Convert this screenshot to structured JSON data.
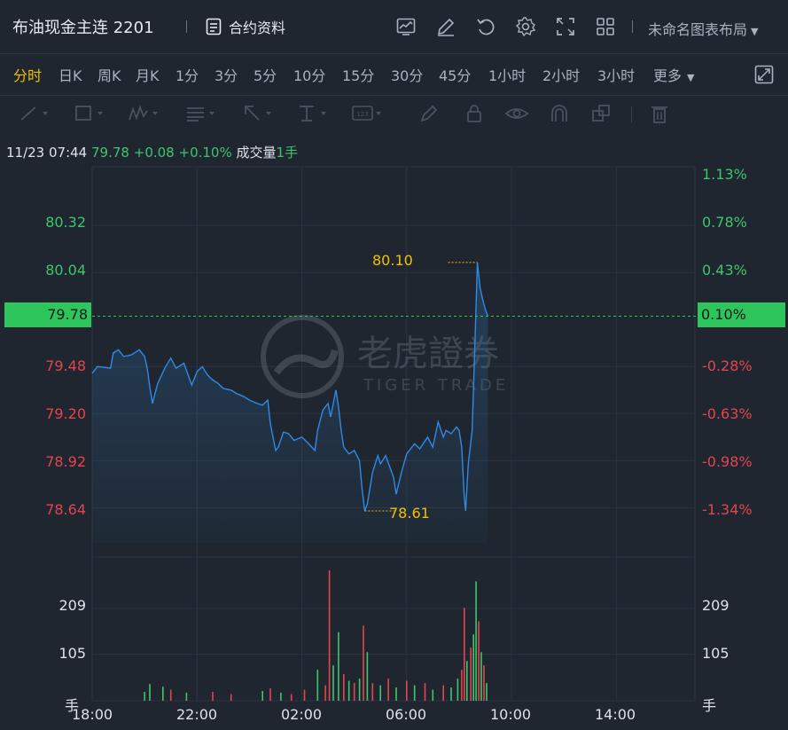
{
  "header": {
    "title": "布油现金主连 2201",
    "info_label": "合约资料",
    "layout_label": "未命名图表布局",
    "icons": [
      "chart-icon",
      "edit-icon",
      "undo-icon",
      "settings-icon",
      "fullscreen-icon",
      "grid-icon"
    ]
  },
  "periods": {
    "items": [
      "分时",
      "日K",
      "周K",
      "月K",
      "1分",
      "3分",
      "5分",
      "10分",
      "15分",
      "30分",
      "45分",
      "1小时",
      "2小时",
      "3小时",
      "更多"
    ],
    "active": "分时"
  },
  "tools": [
    "line-tool-icon",
    "rect-tool-icon",
    "wave-tool-icon",
    "fib-tool-icon",
    "arrow-tool-icon",
    "measure-tool-icon",
    "text-tool-icon",
    "brush-icon",
    "lock-icon",
    "eye-icon",
    "magnet-icon",
    "layers-icon",
    "trash-icon"
  ],
  "info_bar": {
    "time": "11/23 07:44",
    "price": "79.78",
    "change": "+0.08",
    "change_pct": "+0.10%",
    "volume_label": "成交量",
    "volume": "1手"
  },
  "watermark": {
    "name": "老虎證券",
    "sub": "TIGER TRADE"
  },
  "chart_data": {
    "type": "line",
    "price_labels": [
      "80.32",
      "80.04",
      "79.48",
      "79.20",
      "78.92",
      "78.64"
    ],
    "pct_labels": [
      "1.13%",
      "0.78%",
      "0.43%",
      "-0.28%",
      "-0.63%",
      "-0.98%",
      "-1.34%"
    ],
    "current_price": "79.78",
    "current_pct": "0.10%",
    "high_label": "80.10",
    "low_label": "78.61",
    "volume_labels": [
      "209",
      "105"
    ],
    "volume_unit": "手",
    "time_labels": [
      "18:00",
      "22:00",
      "02:00",
      "06:00",
      "10:00",
      "14:00"
    ],
    "ylim": [
      78.43,
      80.67
    ],
    "x_hours_range": [
      0,
      23
    ],
    "vol_ylim": [
      0,
      313
    ],
    "colors": {
      "line": "#2e8ae6",
      "up": "#3ec56c",
      "down": "#e2454e",
      "highlight": "#f0c000"
    },
    "points": [
      [
        0.0,
        79.44
      ],
      [
        0.2,
        79.48
      ],
      [
        0.7,
        79.47
      ],
      [
        0.8,
        79.56
      ],
      [
        1.0,
        79.58
      ],
      [
        1.2,
        79.54
      ],
      [
        1.5,
        79.55
      ],
      [
        1.8,
        79.58
      ],
      [
        2.0,
        79.54
      ],
      [
        2.1,
        79.47
      ],
      [
        2.2,
        79.36
      ],
      [
        2.3,
        79.26
      ],
      [
        2.5,
        79.38
      ],
      [
        2.8,
        79.48
      ],
      [
        3.0,
        79.53
      ],
      [
        3.2,
        79.47
      ],
      [
        3.5,
        79.5
      ],
      [
        3.8,
        79.37
      ],
      [
        4.0,
        79.45
      ],
      [
        4.2,
        79.48
      ],
      [
        4.4,
        79.43
      ],
      [
        4.6,
        79.4
      ],
      [
        4.8,
        79.38
      ],
      [
        5.0,
        79.35
      ],
      [
        5.3,
        79.34
      ],
      [
        5.5,
        79.32
      ],
      [
        5.8,
        79.3
      ],
      [
        6.0,
        79.28
      ],
      [
        6.3,
        79.26
      ],
      [
        6.5,
        79.25
      ],
      [
        6.7,
        79.28
      ],
      [
        6.8,
        79.14
      ],
      [
        6.9,
        79.06
      ],
      [
        7.0,
        78.98
      ],
      [
        7.1,
        79.0
      ],
      [
        7.3,
        79.09
      ],
      [
        7.5,
        79.08
      ],
      [
        7.7,
        79.04
      ],
      [
        8.0,
        79.06
      ],
      [
        8.2,
        79.03
      ],
      [
        8.5,
        78.98
      ],
      [
        8.6,
        79.1
      ],
      [
        8.8,
        79.22
      ],
      [
        9.0,
        79.26
      ],
      [
        9.1,
        79.18
      ],
      [
        9.3,
        79.34
      ],
      [
        9.4,
        79.24
      ],
      [
        9.5,
        79.1
      ],
      [
        9.6,
        79.0
      ],
      [
        9.8,
        78.96
      ],
      [
        10.0,
        78.98
      ],
      [
        10.2,
        78.92
      ],
      [
        10.3,
        78.75
      ],
      [
        10.4,
        78.62
      ],
      [
        10.5,
        78.66
      ],
      [
        10.7,
        78.85
      ],
      [
        10.9,
        78.95
      ],
      [
        11.0,
        78.9
      ],
      [
        11.2,
        78.95
      ],
      [
        11.5,
        78.82
      ],
      [
        11.6,
        78.72
      ],
      [
        11.8,
        78.85
      ],
      [
        12.0,
        78.96
      ],
      [
        12.3,
        79.02
      ],
      [
        12.5,
        78.99
      ],
      [
        12.8,
        79.06
      ],
      [
        13.0,
        79.0
      ],
      [
        13.2,
        79.15
      ],
      [
        13.4,
        79.06
      ],
      [
        13.5,
        79.1
      ],
      [
        13.7,
        79.08
      ],
      [
        13.9,
        79.12
      ],
      [
        14.0,
        79.1
      ],
      [
        14.1,
        79.0
      ],
      [
        14.2,
        78.7
      ],
      [
        14.25,
        78.62
      ],
      [
        14.35,
        78.9
      ],
      [
        14.5,
        79.1
      ],
      [
        14.6,
        79.6
      ],
      [
        14.7,
        80.1
      ],
      [
        14.8,
        79.95
      ],
      [
        14.9,
        79.88
      ],
      [
        15.0,
        79.82
      ],
      [
        15.1,
        79.78
      ]
    ],
    "volumes": [
      [
        2.0,
        20,
        "up"
      ],
      [
        2.2,
        38,
        "up"
      ],
      [
        2.7,
        32,
        "up"
      ],
      [
        3.0,
        25,
        "down"
      ],
      [
        3.6,
        18,
        "up"
      ],
      [
        4.6,
        20,
        "down"
      ],
      [
        5.3,
        15,
        "down"
      ],
      [
        6.5,
        22,
        "up"
      ],
      [
        6.8,
        28,
        "down"
      ],
      [
        7.2,
        18,
        "up"
      ],
      [
        7.6,
        15,
        "down"
      ],
      [
        8.1,
        25,
        "down"
      ],
      [
        8.6,
        70,
        "up"
      ],
      [
        8.9,
        35,
        "down"
      ],
      [
        9.05,
        295,
        "down"
      ],
      [
        9.2,
        80,
        "up"
      ],
      [
        9.4,
        155,
        "up"
      ],
      [
        9.6,
        60,
        "down"
      ],
      [
        9.8,
        45,
        "up"
      ],
      [
        10.0,
        40,
        "down"
      ],
      [
        10.2,
        50,
        "up"
      ],
      [
        10.35,
        170,
        "down"
      ],
      [
        10.5,
        110,
        "up"
      ],
      [
        10.7,
        40,
        "down"
      ],
      [
        11.0,
        35,
        "up"
      ],
      [
        11.3,
        50,
        "down"
      ],
      [
        11.6,
        30,
        "up"
      ],
      [
        12.0,
        45,
        "down"
      ],
      [
        12.3,
        35,
        "up"
      ],
      [
        12.7,
        40,
        "down"
      ],
      [
        13.0,
        25,
        "up"
      ],
      [
        13.4,
        35,
        "down"
      ],
      [
        13.7,
        30,
        "up"
      ],
      [
        13.95,
        50,
        "up"
      ],
      [
        14.1,
        70,
        "down"
      ],
      [
        14.2,
        210,
        "down"
      ],
      [
        14.3,
        90,
        "up"
      ],
      [
        14.45,
        120,
        "down"
      ],
      [
        14.55,
        150,
        "up"
      ],
      [
        14.65,
        270,
        "up"
      ],
      [
        14.75,
        180,
        "down"
      ],
      [
        14.85,
        110,
        "up"
      ],
      [
        14.95,
        80,
        "down"
      ],
      [
        15.05,
        40,
        "up"
      ]
    ]
  }
}
